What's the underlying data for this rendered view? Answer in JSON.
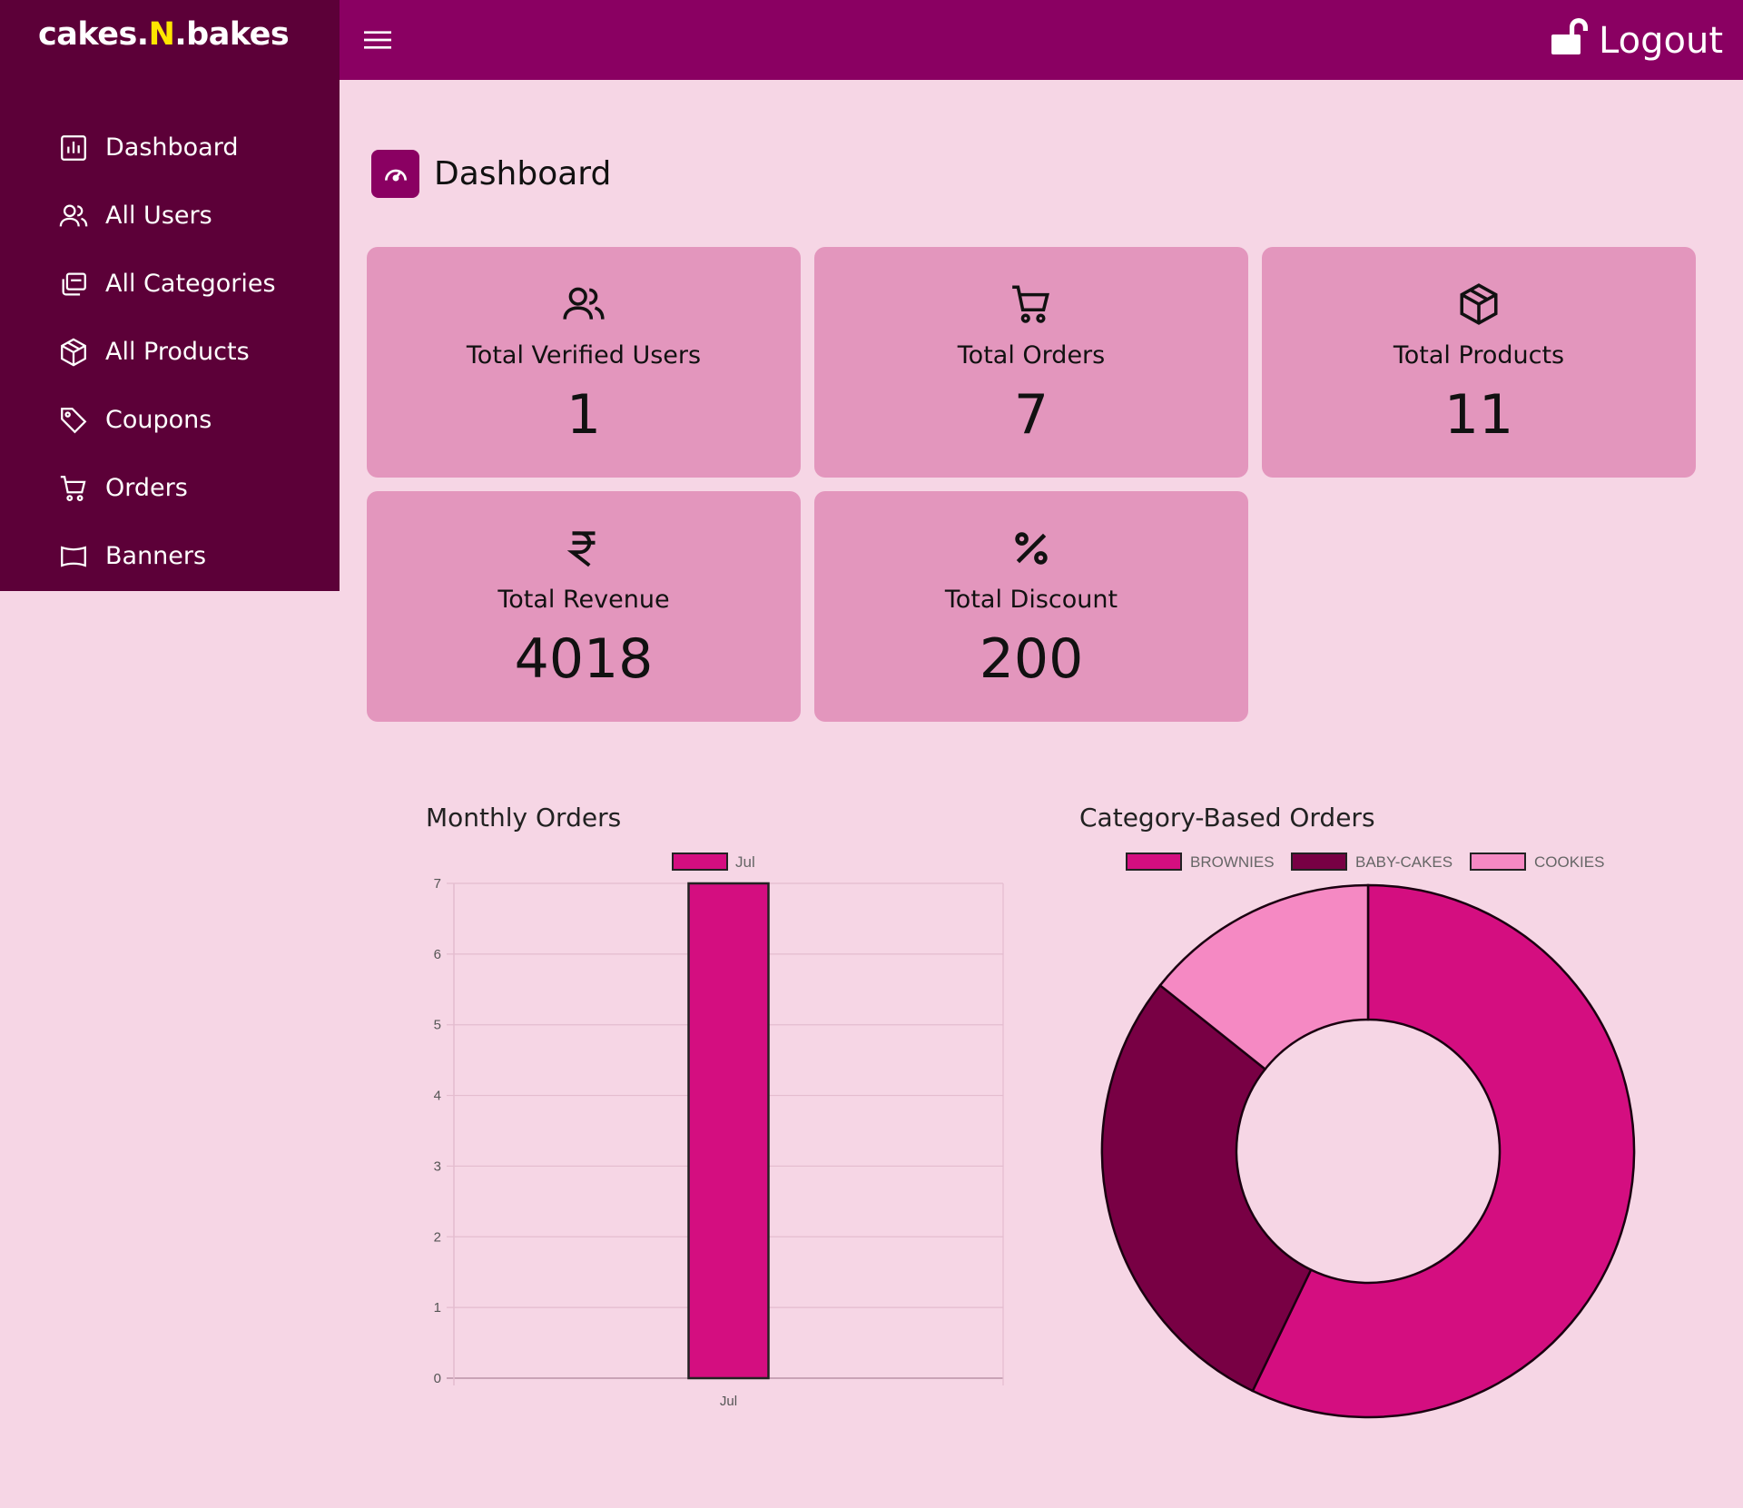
{
  "brand": {
    "part1": "cakes.",
    "part2": "N",
    "part3": ".bakes"
  },
  "sidebar": {
    "items": [
      {
        "label": "Dashboard",
        "icon": "chart-bar-icon"
      },
      {
        "label": "All Users",
        "icon": "users-icon"
      },
      {
        "label": "All Categories",
        "icon": "copy-icon"
      },
      {
        "label": "All Products",
        "icon": "package-icon"
      },
      {
        "label": "Coupons",
        "icon": "tag-icon"
      },
      {
        "label": "Orders",
        "icon": "cart-icon"
      },
      {
        "label": "Banners",
        "icon": "banner-icon"
      }
    ]
  },
  "topbar": {
    "logout_label": "Logout"
  },
  "page": {
    "title": "Dashboard"
  },
  "stats": [
    {
      "label": "Total Verified Users",
      "value": "1",
      "icon": "users-icon"
    },
    {
      "label": "Total Orders",
      "value": "7",
      "icon": "cart-icon"
    },
    {
      "label": "Total Products",
      "value": "11",
      "icon": "package-icon"
    },
    {
      "label": "Total Revenue",
      "value": "4018",
      "icon": "rupee-icon"
    },
    {
      "label": "Total Discount",
      "value": "200",
      "icon": "percent-icon"
    }
  ],
  "colors": {
    "sidebar_bg": "#5c0038",
    "topbar_bg": "#8a0062",
    "page_bg": "#f6d6e5",
    "card_bg": "#e396bd",
    "brand_accent": "#ffe600"
  },
  "chart_data": [
    {
      "type": "bar",
      "title": "Monthly Orders",
      "categories": [
        "Jul"
      ],
      "series": [
        {
          "name": "Jul",
          "values": [
            7
          ],
          "color": "#d40e80"
        }
      ],
      "ylim": [
        0,
        7
      ],
      "yticks": [
        0,
        1,
        2,
        3,
        4,
        5,
        6,
        7
      ],
      "grid": true,
      "legend": "top"
    },
    {
      "type": "pie",
      "subtype": "doughnut",
      "title": "Category-Based Orders",
      "labels": [
        "BROWNIES",
        "BABY-CAKES",
        "COOKIES"
      ],
      "values": [
        4,
        2,
        1
      ],
      "colors": [
        "#d40e80",
        "#780044",
        "#f589c3"
      ],
      "legend": "top"
    }
  ]
}
